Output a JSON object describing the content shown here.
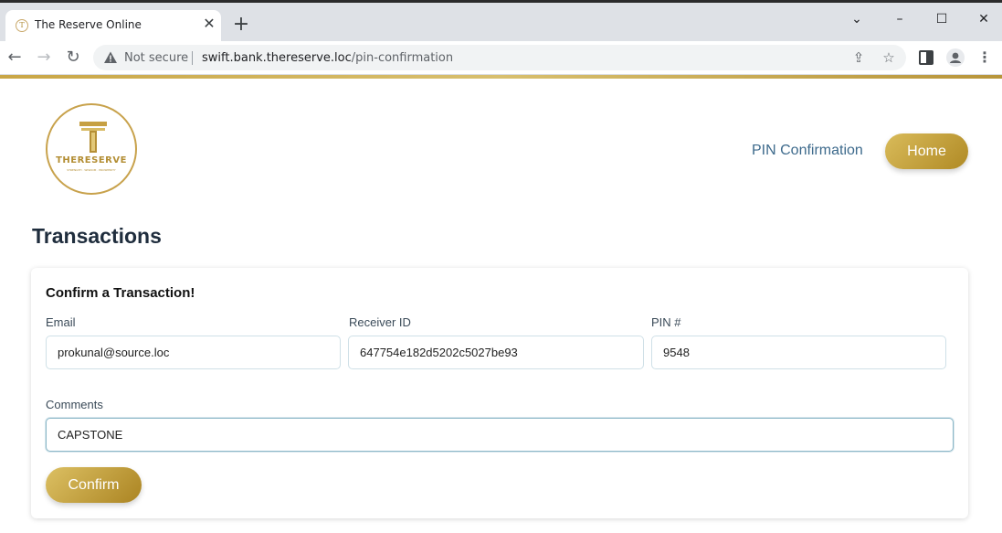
{
  "browser": {
    "tab_title": "The Reserve Online",
    "security_label": "Not secure",
    "url_host": "swift.bank.thereserve.loc",
    "url_path": "/pin-confirmation"
  },
  "header": {
    "logo_name": "THERESERVE",
    "logo_tagline": "STRENGTH · WISDOM · PROSPERITY",
    "nav_link": "PIN Confirmation",
    "home_button": "Home"
  },
  "page": {
    "title": "Transactions"
  },
  "form": {
    "title": "Confirm a Transaction!",
    "email_label": "Email",
    "email_value": "prokunal@source.loc",
    "receiver_label": "Receiver ID",
    "receiver_value": "647754e182d5202c5027be93",
    "pin_label": "PIN #",
    "pin_value": "9548",
    "comments_label": "Comments",
    "comments_value": "CAPSTONE",
    "confirm_button": "Confirm"
  },
  "colors": {
    "accent_gold": "#c9a646",
    "link_blue": "#3d6a8c"
  }
}
